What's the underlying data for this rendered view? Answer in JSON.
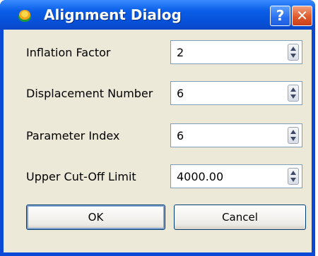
{
  "window": {
    "title": "Alignment Dialog",
    "help_label": "?",
    "close_label": "✕"
  },
  "fields": [
    {
      "label": "Inflation Factor",
      "value": "2"
    },
    {
      "label": "Displacement Number",
      "value": "6"
    },
    {
      "label": "Parameter Index",
      "value": "6"
    },
    {
      "label": "Upper Cut-Off Limit",
      "value": "4000.00"
    }
  ],
  "buttons": {
    "ok_label": "OK",
    "cancel_label": "Cancel"
  },
  "colors": {
    "titlebar": "#0650d8",
    "dialog_bg": "#ece9d8",
    "close_button": "#e05a2c"
  }
}
